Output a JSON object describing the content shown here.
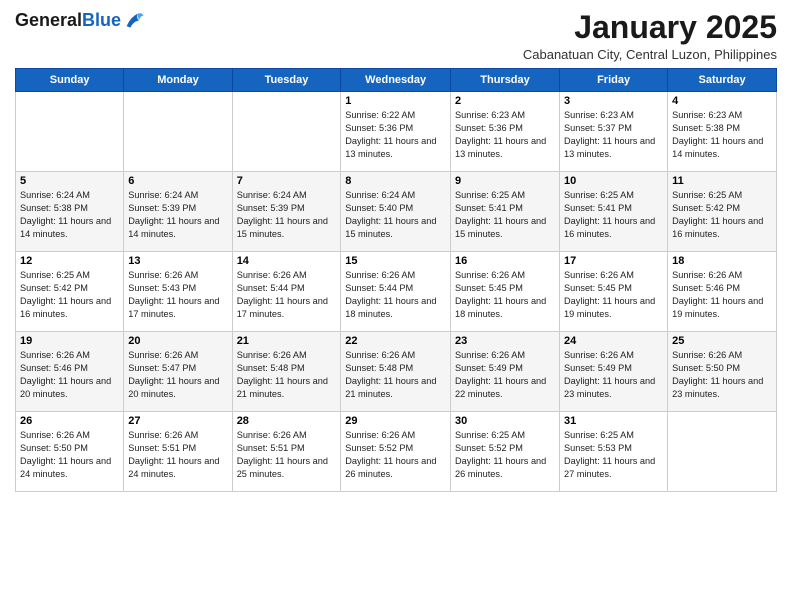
{
  "logo": {
    "general": "General",
    "blue": "Blue"
  },
  "header": {
    "title": "January 2025",
    "subtitle": "Cabanatuan City, Central Luzon, Philippines"
  },
  "days_of_week": [
    "Sunday",
    "Monday",
    "Tuesday",
    "Wednesday",
    "Thursday",
    "Friday",
    "Saturday"
  ],
  "weeks": [
    [
      {
        "day": "",
        "info": ""
      },
      {
        "day": "",
        "info": ""
      },
      {
        "day": "",
        "info": ""
      },
      {
        "day": "1",
        "info": "Sunrise: 6:22 AM\nSunset: 5:36 PM\nDaylight: 11 hours and 13 minutes."
      },
      {
        "day": "2",
        "info": "Sunrise: 6:23 AM\nSunset: 5:36 PM\nDaylight: 11 hours and 13 minutes."
      },
      {
        "day": "3",
        "info": "Sunrise: 6:23 AM\nSunset: 5:37 PM\nDaylight: 11 hours and 13 minutes."
      },
      {
        "day": "4",
        "info": "Sunrise: 6:23 AM\nSunset: 5:38 PM\nDaylight: 11 hours and 14 minutes."
      }
    ],
    [
      {
        "day": "5",
        "info": "Sunrise: 6:24 AM\nSunset: 5:38 PM\nDaylight: 11 hours and 14 minutes."
      },
      {
        "day": "6",
        "info": "Sunrise: 6:24 AM\nSunset: 5:39 PM\nDaylight: 11 hours and 14 minutes."
      },
      {
        "day": "7",
        "info": "Sunrise: 6:24 AM\nSunset: 5:39 PM\nDaylight: 11 hours and 15 minutes."
      },
      {
        "day": "8",
        "info": "Sunrise: 6:24 AM\nSunset: 5:40 PM\nDaylight: 11 hours and 15 minutes."
      },
      {
        "day": "9",
        "info": "Sunrise: 6:25 AM\nSunset: 5:41 PM\nDaylight: 11 hours and 15 minutes."
      },
      {
        "day": "10",
        "info": "Sunrise: 6:25 AM\nSunset: 5:41 PM\nDaylight: 11 hours and 16 minutes."
      },
      {
        "day": "11",
        "info": "Sunrise: 6:25 AM\nSunset: 5:42 PM\nDaylight: 11 hours and 16 minutes."
      }
    ],
    [
      {
        "day": "12",
        "info": "Sunrise: 6:25 AM\nSunset: 5:42 PM\nDaylight: 11 hours and 16 minutes."
      },
      {
        "day": "13",
        "info": "Sunrise: 6:26 AM\nSunset: 5:43 PM\nDaylight: 11 hours and 17 minutes."
      },
      {
        "day": "14",
        "info": "Sunrise: 6:26 AM\nSunset: 5:44 PM\nDaylight: 11 hours and 17 minutes."
      },
      {
        "day": "15",
        "info": "Sunrise: 6:26 AM\nSunset: 5:44 PM\nDaylight: 11 hours and 18 minutes."
      },
      {
        "day": "16",
        "info": "Sunrise: 6:26 AM\nSunset: 5:45 PM\nDaylight: 11 hours and 18 minutes."
      },
      {
        "day": "17",
        "info": "Sunrise: 6:26 AM\nSunset: 5:45 PM\nDaylight: 11 hours and 19 minutes."
      },
      {
        "day": "18",
        "info": "Sunrise: 6:26 AM\nSunset: 5:46 PM\nDaylight: 11 hours and 19 minutes."
      }
    ],
    [
      {
        "day": "19",
        "info": "Sunrise: 6:26 AM\nSunset: 5:46 PM\nDaylight: 11 hours and 20 minutes."
      },
      {
        "day": "20",
        "info": "Sunrise: 6:26 AM\nSunset: 5:47 PM\nDaylight: 11 hours and 20 minutes."
      },
      {
        "day": "21",
        "info": "Sunrise: 6:26 AM\nSunset: 5:48 PM\nDaylight: 11 hours and 21 minutes."
      },
      {
        "day": "22",
        "info": "Sunrise: 6:26 AM\nSunset: 5:48 PM\nDaylight: 11 hours and 21 minutes."
      },
      {
        "day": "23",
        "info": "Sunrise: 6:26 AM\nSunset: 5:49 PM\nDaylight: 11 hours and 22 minutes."
      },
      {
        "day": "24",
        "info": "Sunrise: 6:26 AM\nSunset: 5:49 PM\nDaylight: 11 hours and 23 minutes."
      },
      {
        "day": "25",
        "info": "Sunrise: 6:26 AM\nSunset: 5:50 PM\nDaylight: 11 hours and 23 minutes."
      }
    ],
    [
      {
        "day": "26",
        "info": "Sunrise: 6:26 AM\nSunset: 5:50 PM\nDaylight: 11 hours and 24 minutes."
      },
      {
        "day": "27",
        "info": "Sunrise: 6:26 AM\nSunset: 5:51 PM\nDaylight: 11 hours and 24 minutes."
      },
      {
        "day": "28",
        "info": "Sunrise: 6:26 AM\nSunset: 5:51 PM\nDaylight: 11 hours and 25 minutes."
      },
      {
        "day": "29",
        "info": "Sunrise: 6:26 AM\nSunset: 5:52 PM\nDaylight: 11 hours and 26 minutes."
      },
      {
        "day": "30",
        "info": "Sunrise: 6:25 AM\nSunset: 5:52 PM\nDaylight: 11 hours and 26 minutes."
      },
      {
        "day": "31",
        "info": "Sunrise: 6:25 AM\nSunset: 5:53 PM\nDaylight: 11 hours and 27 minutes."
      },
      {
        "day": "",
        "info": ""
      }
    ]
  ]
}
